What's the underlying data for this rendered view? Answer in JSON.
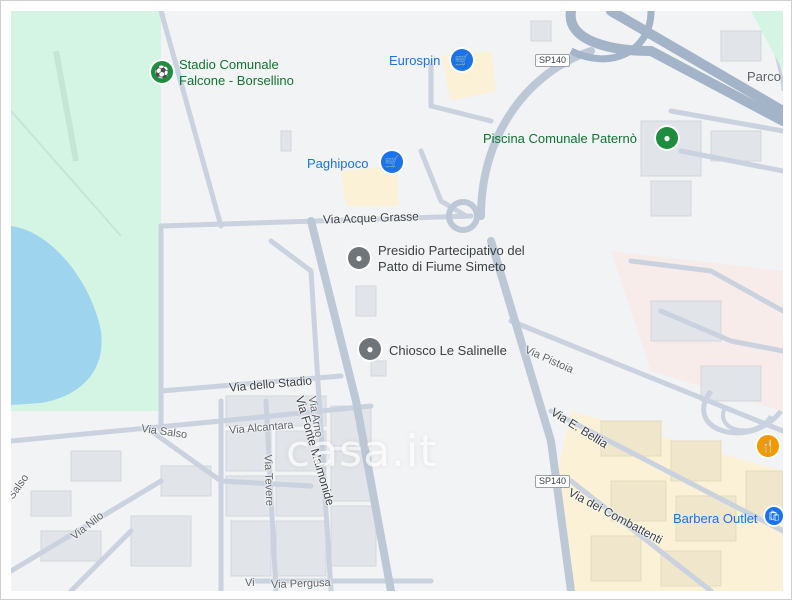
{
  "map": {
    "pois": {
      "stadium_line1": "Stadio Comunale",
      "stadium_line2": "Falcone - Borsellino",
      "eurospin": "Eurospin",
      "paghipoco": "Paghipoco",
      "piscina": "Piscina Comunale Paternò",
      "presidio_line1": "Presidio Partecipativo del",
      "presidio_line2": "Patto di Fiume Simeto",
      "chiosco": "Chiosco Le Salinelle",
      "barbera": "Barbera Outlet",
      "parco": "Parco"
    },
    "streets": {
      "acque_grasse": "Via Acque Grasse",
      "fonte_malmonide": "Via Fonte Malmonide",
      "dello_stadio": "Via dello Stadio",
      "salso_1": "Via Salso",
      "salso_2": "Salso",
      "alcantara": "Via Alcantara",
      "arno": "Via Arno",
      "tevere": "Via Tevere",
      "nilo": "Via Nilo",
      "pistoia": "Via Pistoia",
      "bellia": "Via E. Bellia",
      "combattenti": "Via dei Combattenti",
      "pergusa": "Via Pergusa",
      "vi_fragment": "Vi"
    },
    "shields": {
      "sp140_top": "SP140",
      "sp140_bottom": "SP140"
    },
    "watermark": "casa.it",
    "colors": {
      "park": "#d4f5e3",
      "water": "#9fd4ee",
      "road": "#c8d3e0",
      "highway": "#a3b3c8",
      "building": "#e3e5e8",
      "commercial": "#fbf1d6",
      "poi_green": "#1e8e3e",
      "poi_blue": "#1a73e8",
      "poi_gray": "#70757a",
      "poi_orange": "#f29900"
    },
    "icons": {
      "stadium": "stadium-icon",
      "cart": "shopping-cart-icon",
      "pool": "landmark-icon",
      "place": "place-pin-icon",
      "restaurant": "restaurant-icon",
      "shopping": "shopping-bag-icon"
    }
  }
}
